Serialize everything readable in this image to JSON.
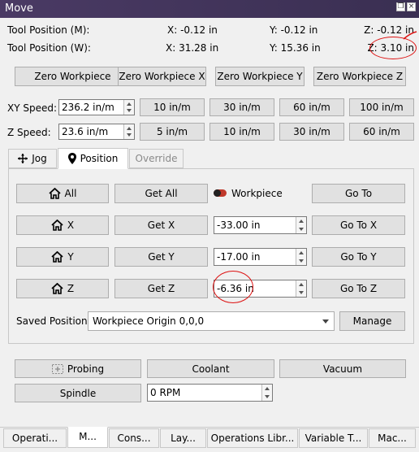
{
  "window": {
    "title": "Move"
  },
  "position": {
    "machine": {
      "label": "Tool Position (M):",
      "x": "X: -0.12 in",
      "y": "Y: -0.12 in",
      "z": "Z: -0.12 in"
    },
    "work": {
      "label": "Tool Position (W):",
      "x": "X: 31.28 in",
      "y": "Y: 15.36 in",
      "z": "Z: 3.10 in"
    }
  },
  "zero_buttons": [
    "Zero Workpiece",
    "Zero Workpiece X",
    "Zero Workpiece Y",
    "Zero Workpiece Z"
  ],
  "xy_speed": {
    "label": "XY Speed:",
    "value": "236.2 in/m",
    "presets": [
      "10 in/m",
      "30 in/m",
      "60 in/m",
      "100 in/m"
    ]
  },
  "z_speed": {
    "label": "Z Speed:",
    "value": "23.6 in/m",
    "presets": [
      "5 in/m",
      "10 in/m",
      "30 in/m",
      "60 in/m"
    ]
  },
  "tabs": [
    {
      "label": "Jog",
      "icon": "move-icon"
    },
    {
      "label": "Position",
      "icon": "location-pin-icon"
    },
    {
      "label": "Override",
      "icon": ""
    }
  ],
  "position_tab": {
    "all": {
      "home_label": "All",
      "get_label": "Get All",
      "toggle_label": "Workpiece",
      "goto_label": "Go To"
    },
    "x": {
      "home_label": "X",
      "get_label": "Get X",
      "value": "-33.00 in",
      "goto_label": "Go To X"
    },
    "y": {
      "home_label": "Y",
      "get_label": "Get Y",
      "value": "-17.00 in",
      "goto_label": "Go To Y"
    },
    "z": {
      "home_label": "Z",
      "get_label": "Get Z",
      "value": "-6.36 in",
      "goto_label": "Go To Z"
    },
    "saved": {
      "label": "Saved Positions",
      "selected": "Workpiece Origin 0,0,0",
      "manage_label": "Manage"
    }
  },
  "bottom": {
    "probing_label": "Probing",
    "coolant_label": "Coolant",
    "vacuum_label": "Vacuum",
    "spindle_label": "Spindle",
    "spindle_value": "0 RPM"
  },
  "bottom_tabs": [
    "Operati...",
    "M...",
    "Cons...",
    "Lay...",
    "Operations Libr...",
    "Variable T...",
    "Mac..."
  ],
  "colors": {
    "titlebar": "#3f3259",
    "annotation": "#d11111",
    "toggle": "#c0392b"
  }
}
